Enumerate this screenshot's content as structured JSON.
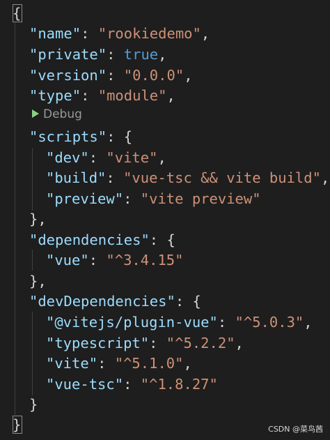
{
  "code": {
    "open_brace": "{",
    "close_brace": "}",
    "name_key": "\"name\"",
    "name_value": "\"rookiedemo\"",
    "private_key": "\"private\"",
    "private_value": "true",
    "version_key": "\"version\"",
    "version_value": "\"0.0.0\"",
    "type_key": "\"type\"",
    "type_value": "\"module\"",
    "codelens_label": "Debug",
    "scripts_key": "\"scripts\"",
    "dev_key": "\"dev\"",
    "dev_value": "\"vite\"",
    "build_key": "\"build\"",
    "build_value": "\"vue-tsc && vite build\"",
    "preview_key": "\"preview\"",
    "preview_value": "\"vite preview\"",
    "dependencies_key": "\"dependencies\"",
    "vue_key": "\"vue\"",
    "vue_value": "\"^3.4.15\"",
    "devdeps_key": "\"devDependencies\"",
    "plugin_vue_key": "\"@vitejs/plugin-vue\"",
    "plugin_vue_value": "\"^5.0.3\"",
    "typescript_key": "\"typescript\"",
    "typescript_value": "\"^5.2.2\"",
    "vite_key": "\"vite\"",
    "vite_value": "\"^5.1.0\"",
    "vuetsc_key": "\"vue-tsc\"",
    "vuetsc_value": "\"^1.8.27\""
  },
  "watermark": "CSDN @菜鸟茜",
  "colors": {
    "background": "#1e1e1e",
    "key": "#9cdcfe",
    "string": "#ce9178",
    "boolean": "#569cd6",
    "punctuation": "#d4d4d4"
  }
}
